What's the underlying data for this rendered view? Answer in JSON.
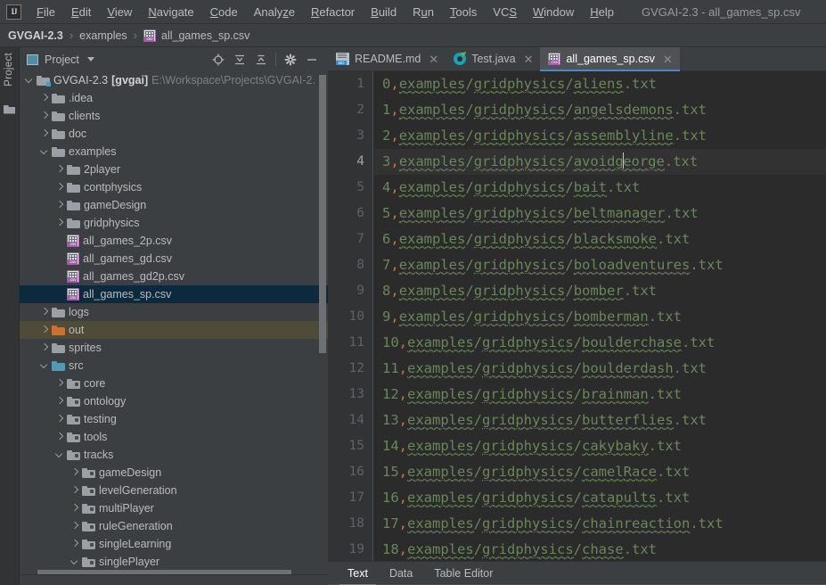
{
  "window": {
    "title": "GVGAI-2.3 - all_games_sp.csv",
    "logo_text": "IJ"
  },
  "menubar": {
    "items": [
      {
        "label": "File",
        "mnemonic": "F"
      },
      {
        "label": "Edit",
        "mnemonic": "E"
      },
      {
        "label": "View",
        "mnemonic": "V"
      },
      {
        "label": "Navigate",
        "mnemonic": "N"
      },
      {
        "label": "Code",
        "mnemonic": "C"
      },
      {
        "label": "Analyze",
        "mnemonic": "z"
      },
      {
        "label": "Refactor",
        "mnemonic": "R"
      },
      {
        "label": "Build",
        "mnemonic": "B"
      },
      {
        "label": "Run",
        "mnemonic": "u"
      },
      {
        "label": "Tools",
        "mnemonic": "T"
      },
      {
        "label": "VCS",
        "mnemonic": "S"
      },
      {
        "label": "Window",
        "mnemonic": "W"
      },
      {
        "label": "Help",
        "mnemonic": "H"
      }
    ]
  },
  "breadcrumb": {
    "project": "GVGAI-2.3",
    "folder": "examples",
    "file": "all_games_sp.csv",
    "separator": "›"
  },
  "stripe": {
    "label": "Project"
  },
  "project_panel": {
    "title": "Project",
    "tools": [
      "locate-target-icon",
      "expand-all-icon",
      "collapse-all-icon",
      "settings-gear-icon",
      "hide-minimize-icon"
    ],
    "tree": [
      {
        "label": "GVGAI-2.3",
        "bold_label": "[gvgai]",
        "path_label": "E:\\Workspace\\Projects\\GVGAI-2.",
        "indent": 0,
        "arrow": "down",
        "icon": "folder-project",
        "state": "normal"
      },
      {
        "label": ".idea",
        "indent": 1,
        "arrow": "right",
        "icon": "folder-gray",
        "state": "normal"
      },
      {
        "label": "clients",
        "indent": 1,
        "arrow": "right",
        "icon": "folder-gray",
        "state": "normal"
      },
      {
        "label": "doc",
        "indent": 1,
        "arrow": "right",
        "icon": "folder-gray",
        "state": "normal"
      },
      {
        "label": "examples",
        "indent": 1,
        "arrow": "down",
        "icon": "folder-gray",
        "state": "normal"
      },
      {
        "label": "2player",
        "indent": 2,
        "arrow": "right",
        "icon": "folder-gray",
        "state": "normal"
      },
      {
        "label": "contphysics",
        "indent": 2,
        "arrow": "right",
        "icon": "folder-gray",
        "state": "normal"
      },
      {
        "label": "gameDesign",
        "indent": 2,
        "arrow": "right",
        "icon": "folder-gray",
        "state": "normal"
      },
      {
        "label": "gridphysics",
        "indent": 2,
        "arrow": "right",
        "icon": "folder-gray",
        "state": "normal"
      },
      {
        "label": "all_games_2p.csv",
        "indent": 2,
        "arrow": "none",
        "icon": "csv-file",
        "state": "normal"
      },
      {
        "label": "all_games_gd.csv",
        "indent": 2,
        "arrow": "none",
        "icon": "csv-file",
        "state": "normal"
      },
      {
        "label": "all_games_gd2p.csv",
        "indent": 2,
        "arrow": "none",
        "icon": "csv-file",
        "state": "normal"
      },
      {
        "label": "all_games_sp.csv",
        "indent": 2,
        "arrow": "none",
        "icon": "csv-file",
        "state": "selected"
      },
      {
        "label": "logs",
        "indent": 1,
        "arrow": "right",
        "icon": "folder-gray",
        "state": "normal"
      },
      {
        "label": "out",
        "indent": 1,
        "arrow": "right",
        "icon": "folder-orange",
        "state": "hovered"
      },
      {
        "label": "sprites",
        "indent": 1,
        "arrow": "right",
        "icon": "folder-gray",
        "state": "normal"
      },
      {
        "label": "src",
        "indent": 1,
        "arrow": "down",
        "icon": "folder-blue",
        "state": "normal"
      },
      {
        "label": "core",
        "indent": 2,
        "arrow": "right",
        "icon": "folder-source",
        "state": "normal"
      },
      {
        "label": "ontology",
        "indent": 2,
        "arrow": "right",
        "icon": "folder-source",
        "state": "normal"
      },
      {
        "label": "testing",
        "indent": 2,
        "arrow": "right",
        "icon": "folder-source",
        "state": "normal"
      },
      {
        "label": "tools",
        "indent": 2,
        "arrow": "right",
        "icon": "folder-source",
        "state": "normal"
      },
      {
        "label": "tracks",
        "indent": 2,
        "arrow": "down",
        "icon": "folder-source",
        "state": "normal"
      },
      {
        "label": "gameDesign",
        "indent": 3,
        "arrow": "right",
        "icon": "folder-source",
        "state": "normal"
      },
      {
        "label": "levelGeneration",
        "indent": 3,
        "arrow": "right",
        "icon": "folder-source",
        "state": "normal"
      },
      {
        "label": "multiPlayer",
        "indent": 3,
        "arrow": "right",
        "icon": "folder-source",
        "state": "normal"
      },
      {
        "label": "ruleGeneration",
        "indent": 3,
        "arrow": "right",
        "icon": "folder-source",
        "state": "normal"
      },
      {
        "label": "singleLearning",
        "indent": 3,
        "arrow": "right",
        "icon": "folder-source",
        "state": "normal"
      },
      {
        "label": "singlePlayer",
        "indent": 3,
        "arrow": "down",
        "icon": "folder-source",
        "state": "normal"
      }
    ]
  },
  "editor": {
    "tabs": [
      {
        "label": "README.md",
        "icon": "markdown-file-icon",
        "active": false
      },
      {
        "label": "Test.java",
        "icon": "java-class-icon",
        "active": false
      },
      {
        "label": "all_games_sp.csv",
        "icon": "csv-file-icon",
        "active": true
      }
    ],
    "caret_line": 4,
    "caret_after": "3,examples/gridphysics/avoidg",
    "lines": [
      {
        "no": "1",
        "index": "0",
        "path": "examples/gridphysics/aliens.txt"
      },
      {
        "no": "2",
        "index": "1",
        "path": "examples/gridphysics/angelsdemons.txt"
      },
      {
        "no": "3",
        "index": "2",
        "path": "examples/gridphysics/assemblyline.txt"
      },
      {
        "no": "4",
        "index": "3",
        "path": "examples/gridphysics/avoidgeorge.txt"
      },
      {
        "no": "5",
        "index": "4",
        "path": "examples/gridphysics/bait.txt"
      },
      {
        "no": "6",
        "index": "5",
        "path": "examples/gridphysics/beltmanager.txt"
      },
      {
        "no": "7",
        "index": "6",
        "path": "examples/gridphysics/blacksmoke.txt"
      },
      {
        "no": "8",
        "index": "7",
        "path": "examples/gridphysics/boloadventures.txt"
      },
      {
        "no": "9",
        "index": "8",
        "path": "examples/gridphysics/bomber.txt"
      },
      {
        "no": "10",
        "index": "9",
        "path": "examples/gridphysics/bomberman.txt"
      },
      {
        "no": "11",
        "index": "10",
        "path": "examples/gridphysics/boulderchase.txt"
      },
      {
        "no": "12",
        "index": "11",
        "path": "examples/gridphysics/boulderdash.txt"
      },
      {
        "no": "13",
        "index": "12",
        "path": "examples/gridphysics/brainman.txt"
      },
      {
        "no": "14",
        "index": "13",
        "path": "examples/gridphysics/butterflies.txt"
      },
      {
        "no": "15",
        "index": "14",
        "path": "examples/gridphysics/cakybaky.txt"
      },
      {
        "no": "16",
        "index": "15",
        "path": "examples/gridphysics/camelRace.txt"
      },
      {
        "no": "17",
        "index": "16",
        "path": "examples/gridphysics/catapults.txt"
      },
      {
        "no": "18",
        "index": "17",
        "path": "examples/gridphysics/chainreaction.txt"
      },
      {
        "no": "19",
        "index": "18",
        "path": "examples/gridphysics/chase.txt"
      }
    ],
    "bottom_tabs": [
      {
        "label": "Text",
        "active": true
      },
      {
        "label": "Data",
        "active": false
      },
      {
        "label": "Table Editor",
        "active": false
      }
    ]
  },
  "colors": {
    "accent_blue": "#4a88c7",
    "panel_bg": "#3c3f41",
    "editor_bg": "#2b2b2b",
    "selection_blue": "#0d293e",
    "hover_olive": "#4e4b37",
    "string_green": "#6a8759",
    "comma_orange": "#cc7832",
    "folder_orange": "#d1702a",
    "folder_blue": "#4d9bb8"
  }
}
